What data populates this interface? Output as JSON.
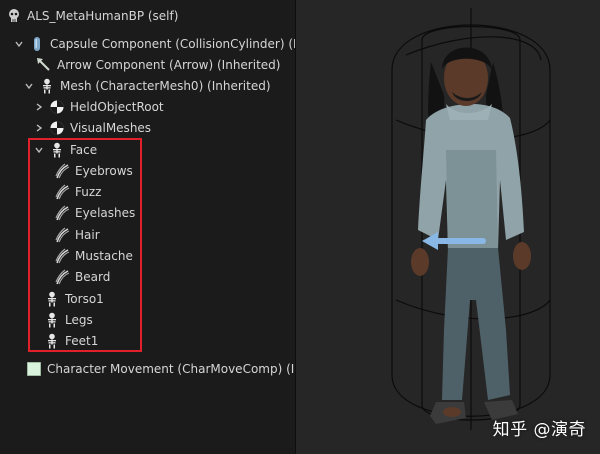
{
  "tree": {
    "root_label": "ALS_MetaHumanBP (self)",
    "capsule_label": "Capsule Component (CollisionCylinder) (Inheri",
    "arrow_label": "Arrow Component (Arrow) (Inherited)",
    "mesh_label": "Mesh (CharacterMesh0) (Inherited)",
    "held_object_label": "HeldObjectRoot",
    "visual_meshes_label": "VisualMeshes",
    "face_label": "Face",
    "eyebrows_label": "Eyebrows",
    "fuzz_label": "Fuzz",
    "eyelashes_label": "Eyelashes",
    "hair_label": "Hair",
    "mustache_label": "Mustache",
    "beard_label": "Beard",
    "torso_label": "Torso1",
    "legs_label": "Legs",
    "feet_label": "Feet1",
    "movement_label": "Character Movement (CharMoveComp) (Inheri"
  },
  "icons": {
    "root": "skeleton-head-icon",
    "capsule": "capsule-icon",
    "arrow": "arrow-icon",
    "skeletal_mesh": "skeleton-icon",
    "scene": "scene-component-icon",
    "groom": "groom-hair-icon",
    "movement": "movement-component-icon"
  },
  "colors": {
    "panel_bg": "#1b1b1b",
    "text": "#d6d6d6",
    "highlight": "#e0202a",
    "viewport_bg": "#262626",
    "character_shirt": "#8fa3a8",
    "character_pants": "#4f6168",
    "arrow_marker": "#8ab8e6"
  },
  "viewport": {
    "watermark": "知乎 @演奇"
  }
}
